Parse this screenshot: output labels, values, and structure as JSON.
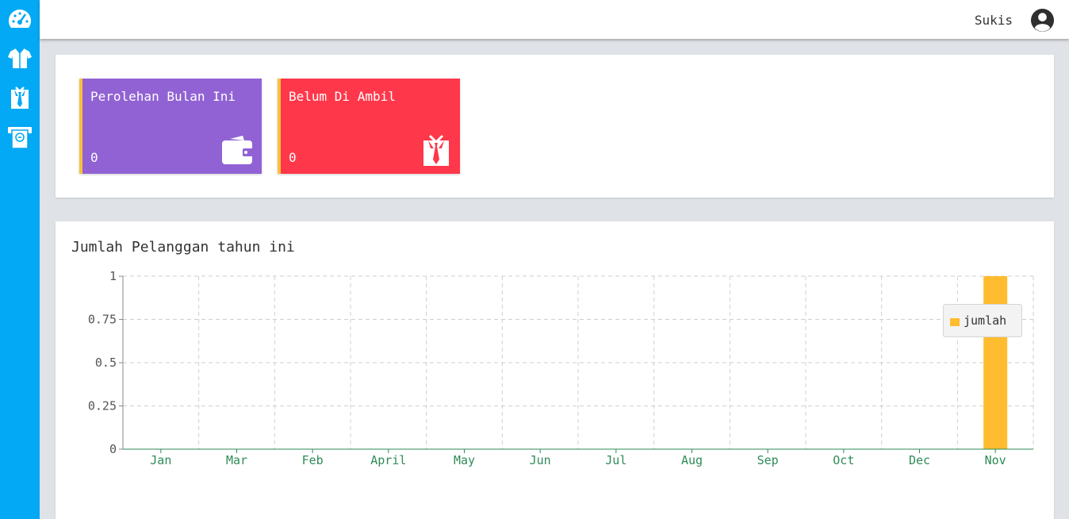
{
  "sidebar": {
    "items": [
      {
        "icon": "dashboard-gauge-icon"
      },
      {
        "icon": "shirt-icon"
      },
      {
        "icon": "suit-tie-icon"
      },
      {
        "icon": "atm-cash-icon"
      }
    ]
  },
  "topbar": {
    "user_name": "Sukis",
    "avatar_icon": "user-avatar-icon"
  },
  "cards": [
    {
      "title": "Perolehan Bulan Ini",
      "value": "0",
      "icon": "wallet-icon",
      "color": "#9162d4"
    },
    {
      "title": "Belum Di Ambil",
      "value": "0",
      "icon": "suit-tie-icon",
      "color": "#ff374b"
    }
  ],
  "chart_title": "Jumlah Pelanggan tahun ini",
  "colors": {
    "sidebar": "#03a9f4",
    "card_accent": "#f7c23a",
    "bar": "#ffbc2e",
    "axis_label": "#2e8b57"
  },
  "chart_data": {
    "type": "bar",
    "title": "Jumlah Pelanggan tahun ini",
    "categories": [
      "Jan",
      "Mar",
      "Feb",
      "April",
      "May",
      "Jun",
      "Jul",
      "Aug",
      "Sep",
      "Oct",
      "Dec",
      "Nov"
    ],
    "series": [
      {
        "name": "jumlah",
        "values": [
          0,
          0,
          0,
          0,
          0,
          0,
          0,
          0,
          0,
          0,
          0,
          1
        ]
      }
    ],
    "y_ticks": [
      "0",
      "0.25",
      "0.5",
      "0.75",
      "1"
    ],
    "ylim": [
      0,
      1
    ],
    "grid": true,
    "legend": "right"
  }
}
